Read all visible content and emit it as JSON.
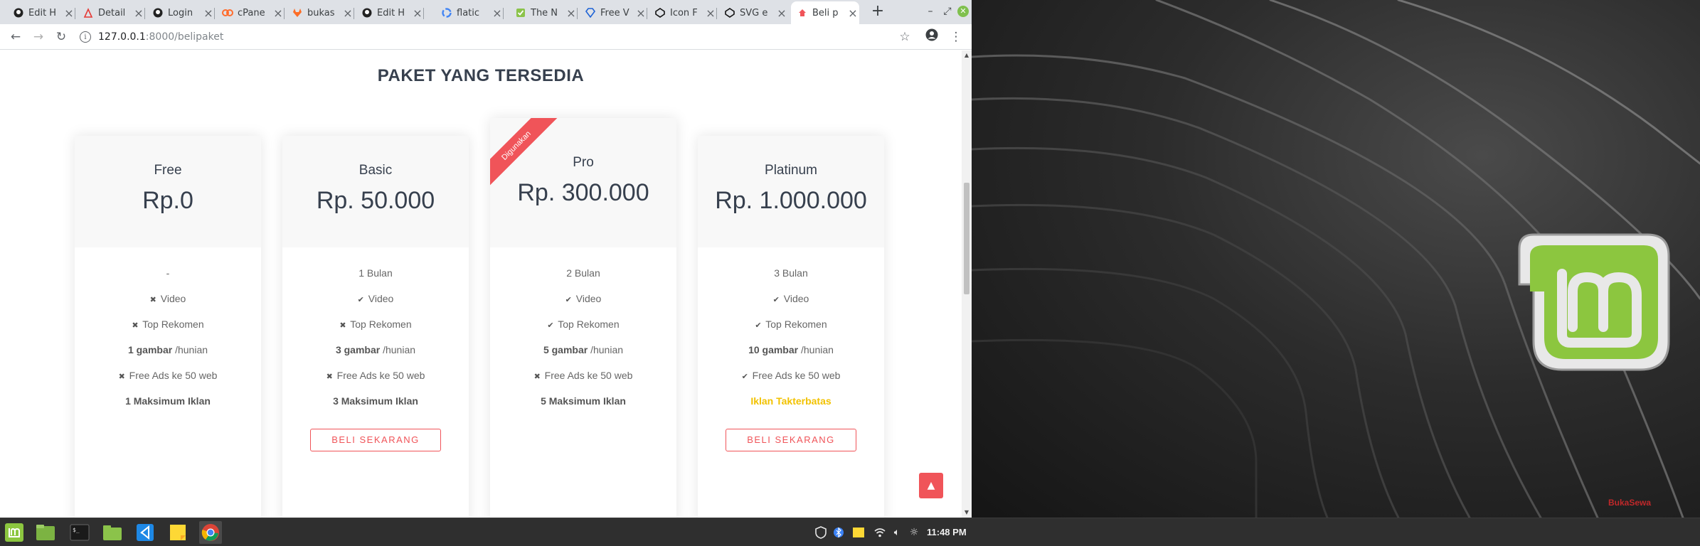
{
  "browser": {
    "tabs": [
      {
        "label": "Edit H",
        "icon": "github-icon"
      },
      {
        "label": "Detail",
        "icon": "pdf-icon"
      },
      {
        "label": "Login",
        "icon": "github-icon"
      },
      {
        "label": "cPane",
        "icon": "cpanel-icon"
      },
      {
        "label": "bukas",
        "icon": "gitlab-icon"
      },
      {
        "label": "Edit H",
        "icon": "github-icon"
      },
      {
        "label": "flatic",
        "icon": "google-icon"
      },
      {
        "label": "The N",
        "icon": "check-icon"
      },
      {
        "label": "Free V",
        "icon": "diamond-icon"
      },
      {
        "label": "Icon F",
        "icon": "codepen-icon"
      },
      {
        "label": "SVG e",
        "icon": "codepen-icon"
      },
      {
        "label": "Beli p",
        "icon": "app-icon"
      }
    ],
    "url_host": "127.0.0.1",
    "url_path": ":8000/belipaket"
  },
  "page": {
    "title": "PAKET YANG TERSEDIA",
    "ribbon_label": "Digunakan",
    "plans": [
      {
        "name": "Free",
        "price": "Rp.0",
        "duration": "-",
        "video": {
          "icon": "cross-icon",
          "text": "Video"
        },
        "top": {
          "icon": "cross-icon",
          "text": "Top Rekomen"
        },
        "images_bold": "1 gambar",
        "images_rest": " /hunian",
        "ads": {
          "icon": "cross-icon",
          "text": "Free Ads ke 50 web"
        },
        "limit": "1 Maksimum Iklan",
        "button": ""
      },
      {
        "name": "Basic",
        "price": "Rp. 50.000",
        "duration": "1 Bulan",
        "video": {
          "icon": "check-icon",
          "text": "Video"
        },
        "top": {
          "icon": "cross-icon",
          "text": "Top Rekomen"
        },
        "images_bold": "3 gambar",
        "images_rest": " /hunian",
        "ads": {
          "icon": "cross-icon",
          "text": "Free Ads ke 50 web"
        },
        "limit": "3 Maksimum Iklan",
        "button": "BELI SEKARANG"
      },
      {
        "name": "Pro",
        "price": "Rp. 300.000",
        "duration": "2 Bulan",
        "video": {
          "icon": "check-icon",
          "text": "Video"
        },
        "top": {
          "icon": "check-icon",
          "text": "Top Rekomen"
        },
        "images_bold": "5 gambar",
        "images_rest": " /hunian",
        "ads": {
          "icon": "cross-icon",
          "text": "Free Ads ke 50 web"
        },
        "limit": "5 Maksimum Iklan",
        "button": ""
      },
      {
        "name": "Platinum",
        "price": "Rp. 1.000.000",
        "duration": "3 Bulan",
        "video": {
          "icon": "check-icon",
          "text": "Video"
        },
        "top": {
          "icon": "check-icon",
          "text": "Top Rekomen"
        },
        "images_bold": "10 gambar",
        "images_rest": " /hunian",
        "ads": {
          "icon": "check-icon",
          "text": "Free Ads ke 50 web"
        },
        "limit": "Iklan Takterbatas",
        "button": "BELI SEKARANG"
      }
    ]
  },
  "desktop": {
    "watermark": "BukaSewa"
  },
  "taskbar": {
    "clock": "11:48 PM",
    "apps": [
      "mint-menu-icon",
      "files-icon",
      "terminal-icon",
      "folder-icon",
      "vscode-icon",
      "notes-icon",
      "chrome-icon"
    ]
  },
  "colors": {
    "accent": "#f05459",
    "gold": "#f2c200",
    "heading": "#37404e",
    "mint": "#8cc63f"
  }
}
